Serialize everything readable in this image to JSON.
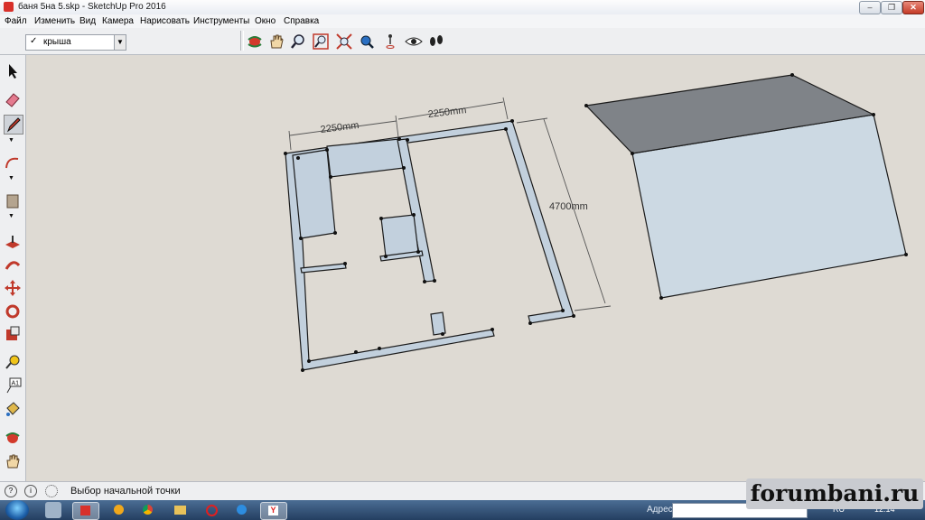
{
  "window": {
    "title": "баня 5на 5.skp - SketchUp Pro 2016",
    "controls": {
      "minimize": "–",
      "maximize": "❐",
      "close": "✕"
    }
  },
  "menu": {
    "items": [
      "Файл",
      "Изменить",
      "Вид",
      "Камера",
      "Нарисовать",
      "Инструменты",
      "Окно",
      "Справка"
    ]
  },
  "layers": {
    "check": "✓",
    "current": "крыша",
    "arrow": "▼"
  },
  "toolbar_icons": [
    "orbit-icon",
    "pan-icon",
    "zoom-icon",
    "zoom-window-icon",
    "zoom-extents-icon",
    "previous-view-icon",
    "position-camera-icon",
    "look-around-icon",
    "walk-icon"
  ],
  "left_toolbar_icons": [
    "select-icon",
    "eraser-icon",
    "pencil-icon",
    "arc-icon",
    "rectangle-icon",
    "push-pull-icon",
    "follow-me-icon",
    "move-icon",
    "rotate-icon",
    "scale-icon",
    "tape-measure-icon",
    "text-icon",
    "paint-bucket-icon",
    "orbit-icon",
    "pan-icon"
  ],
  "model": {
    "dimensions": [
      "2250mm",
      "2250mm",
      "4700mm"
    ]
  },
  "status": {
    "text": "Выбор начальной точки",
    "help_icon": "?",
    "info_icon": "i"
  },
  "taskbar": {
    "address_label": "Адрес",
    "lang": "RU",
    "clock": "12:14"
  },
  "watermark": "forumbani.ru",
  "colors": {
    "wall_fill": "#c2d0dd",
    "roof_fill": "#7f8388",
    "box_fill": "#ccd9e3",
    "background": "#dedad3"
  }
}
